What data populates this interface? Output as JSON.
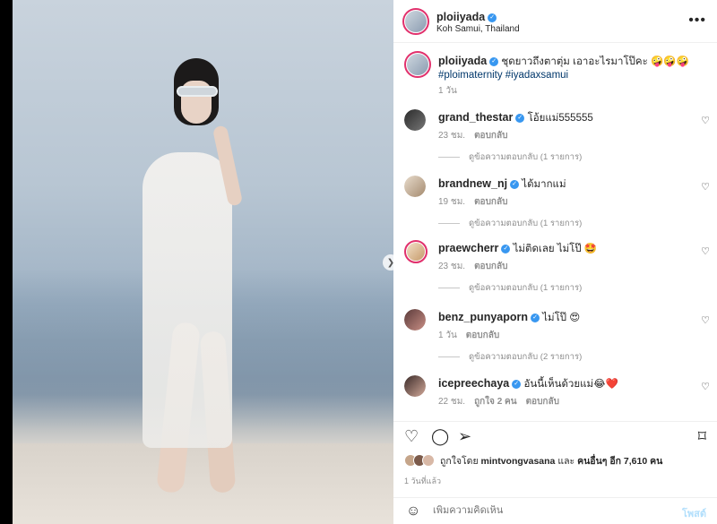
{
  "post": {
    "author": "ploiiyada",
    "location": "Koh Samui, Thailand",
    "more_icon": "more-horizontal-icon",
    "caption_text": "ชุดยาวถึงตาตุ่ม เอาอะไรมาโป๊คะ 🤪🤪🤪",
    "hashtags": "#ploimaternity #iyadaxsamui",
    "caption_time": "1 วัน"
  },
  "comments": [
    {
      "username": "grand_thestar",
      "text": "โอ้ยแม่555555",
      "time": "23 ชม.",
      "reply": "ตอบกลับ",
      "view_replies": "ดูข้อความตอบกลับ (1 รายการ)",
      "likes": ""
    },
    {
      "username": "brandnew_nj",
      "text": "ได้มากแม่",
      "time": "19 ชม.",
      "reply": "ตอบกลับ",
      "view_replies": "ดูข้อความตอบกลับ (1 รายการ)",
      "likes": ""
    },
    {
      "username": "praewcherr",
      "text": "ไม่ติดเลย ไม่โป๊ 🤩",
      "time": "23 ชม.",
      "reply": "ตอบกลับ",
      "view_replies": "ดูข้อความตอบกลับ (1 รายการ)",
      "likes": ""
    },
    {
      "username": "benz_punyaporn",
      "text": "ไม่โป๊ 😍",
      "time": "1 วัน",
      "reply": "ตอบกลับ",
      "view_replies": "ดูข้อความตอบกลับ (2 รายการ)",
      "likes": ""
    },
    {
      "username": "icepreechaya",
      "text": "อันนี้เห็นด้วยแม่😂❤️",
      "time": "22 ชม.",
      "likes": "ถูกใจ 2 คน",
      "reply": "ตอบกลับ",
      "view_replies": ""
    }
  ],
  "likes": {
    "prefix": "ถูกใจโดย",
    "user": "mintvongvasana",
    "mid": "และ",
    "others": "คนอื่นๆ อีก 7,610 คน"
  },
  "post_age": "1 วันที่แล้ว",
  "add_comment": {
    "placeholder": "เพิ่มความคิดเห็น",
    "post_label": "โพสต์"
  },
  "colors": {
    "verified": "#3897f0",
    "story_ring": "#e1306c",
    "hashtag": "#00376b",
    "post_disabled": "#b2dffc"
  }
}
